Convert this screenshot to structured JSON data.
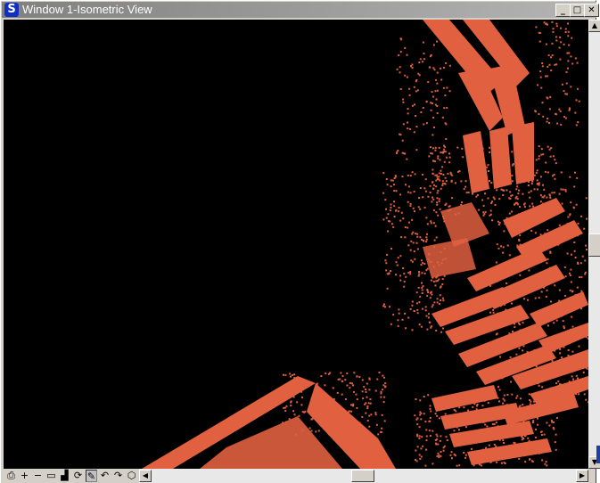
{
  "window": {
    "title": "Window 1-Isometric View",
    "app_icon_glyph": "S",
    "controls": {
      "minimize_glyph": "_",
      "maximize_glyph": "□",
      "close_glyph": "✕"
    }
  },
  "viewport": {
    "background": "#000000",
    "point_color": "#e06040",
    "description_icon": "point-cloud-render"
  },
  "toolbar": {
    "tools": [
      {
        "name": "print-icon",
        "glyph": "⎙"
      },
      {
        "name": "zoom-in-icon",
        "glyph": "+"
      },
      {
        "name": "zoom-out-icon",
        "glyph": "−"
      },
      {
        "name": "window-area-icon",
        "glyph": "▭"
      },
      {
        "name": "fit-view-icon",
        "glyph": "▟"
      },
      {
        "name": "rotate-view-icon",
        "glyph": "⟳"
      },
      {
        "name": "pan-view-icon",
        "glyph": "✎"
      },
      {
        "name": "undo-view-icon",
        "glyph": "↶"
      },
      {
        "name": "redo-view-icon",
        "glyph": "↷"
      },
      {
        "name": "view-cube-icon",
        "glyph": "⬡"
      }
    ],
    "active_tool": "pan-view-icon"
  },
  "scrollbars": {
    "vertical": {
      "up_glyph": "▲",
      "down_glyph": "▼",
      "position": 0.5
    },
    "horizontal": {
      "left_glyph": "◀",
      "right_glyph": "▶",
      "position": 0.5
    }
  }
}
